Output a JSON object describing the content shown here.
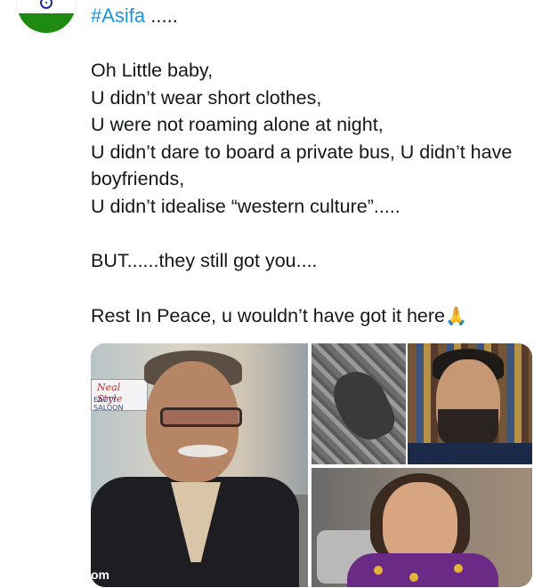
{
  "tweet": {
    "hashtag": "#Asifa",
    "hashtag_suffix": " .....",
    "lines": [
      "Oh Little baby,",
      "U didn’t wear short clothes,",
      "U were not roaming alone at night,",
      "U didn’t dare to board a private bus, U didn’t have boyfriends,",
      "U didn’t idealise “western culture”....."
    ],
    "line_but": "BUT......they still got you....",
    "line_rip": "Rest In Peace, u wouldn’t have got it here",
    "emoji": "🙏",
    "media": {
      "sign_line1": "Neal Style",
      "sign_line2": "EAUTY SALOON",
      "watermark": "om"
    }
  },
  "colors": {
    "link": "#1b95e0",
    "text": "#14171a"
  }
}
